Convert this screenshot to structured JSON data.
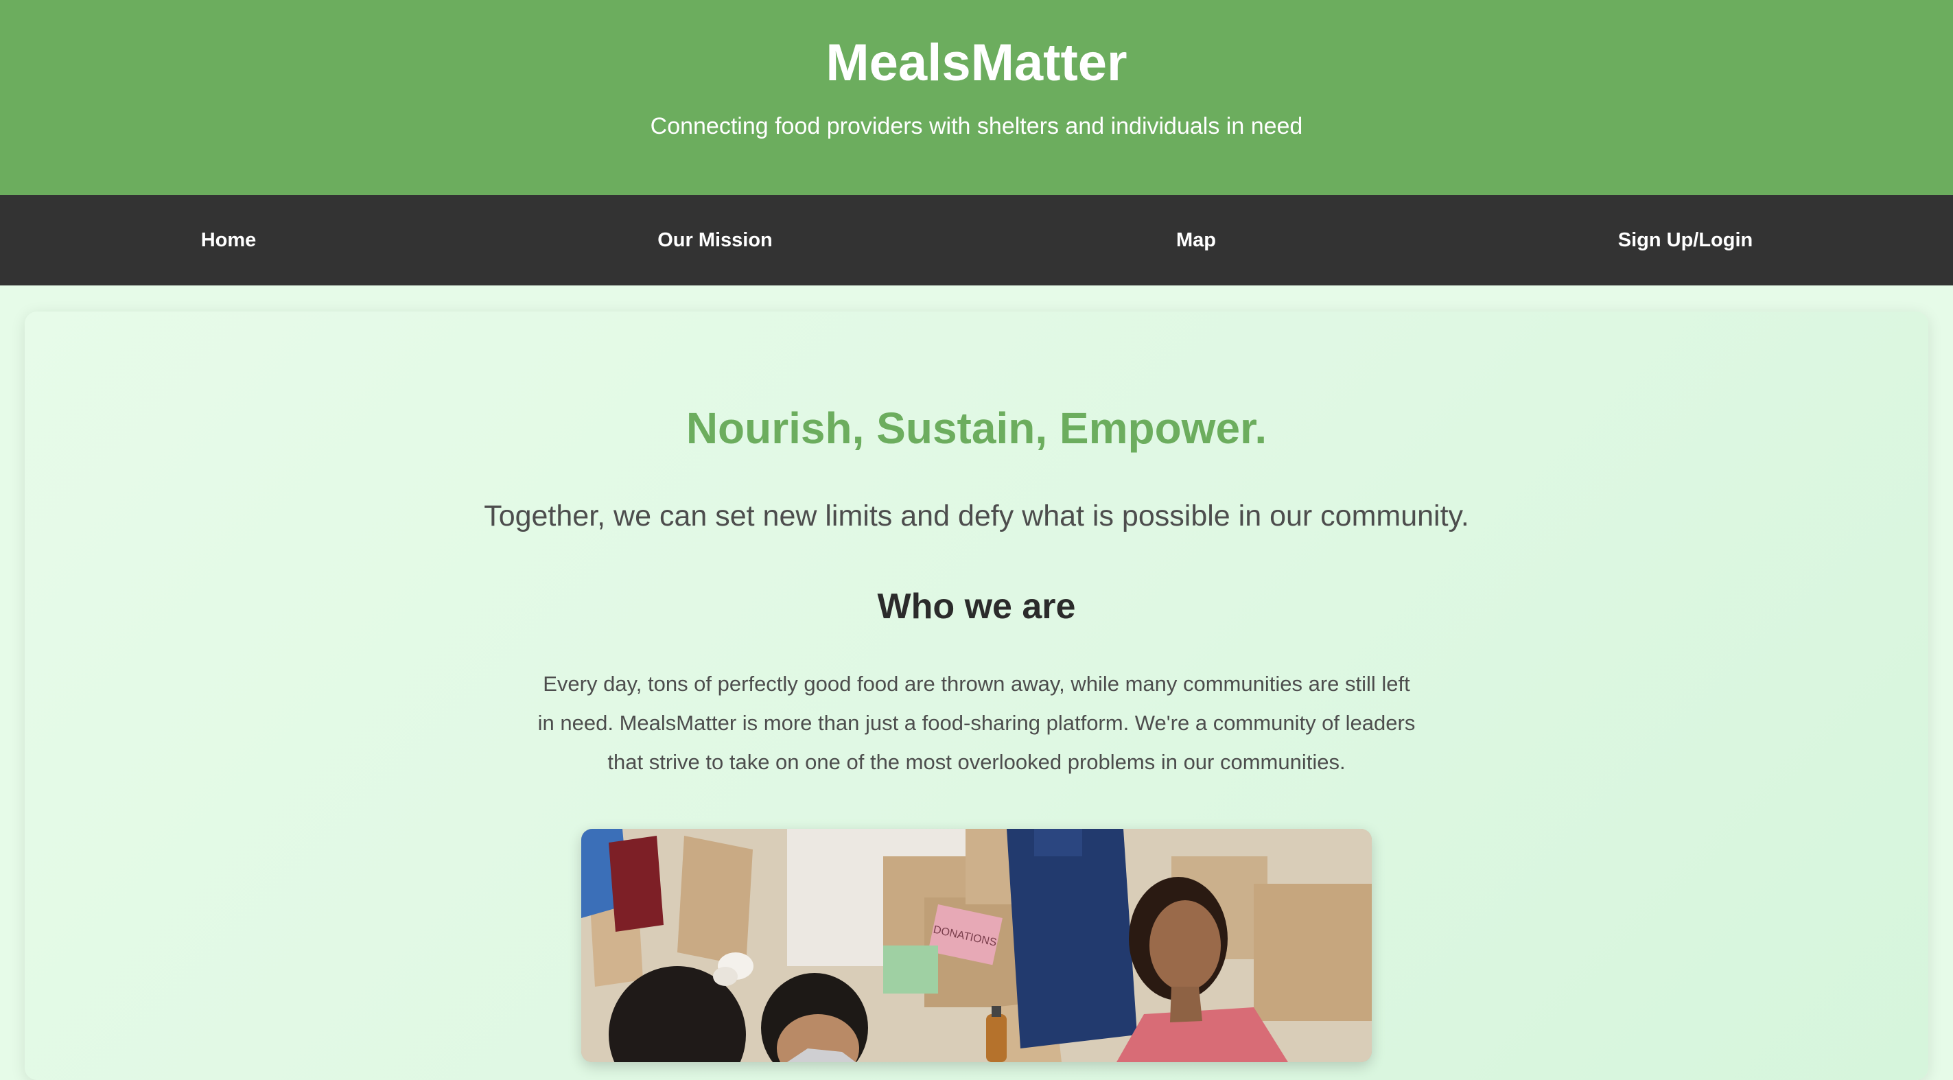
{
  "header": {
    "title": "MealsMatter",
    "tagline": "Connecting food providers with shelters and individuals in need"
  },
  "nav": {
    "items": [
      {
        "label": "Home"
      },
      {
        "label": "Our Mission"
      },
      {
        "label": "Map"
      },
      {
        "label": "Sign Up/Login"
      }
    ]
  },
  "main": {
    "hero_heading": "Nourish, Sustain, Empower.",
    "hero_subheading": "Together, we can set new limits and defy what is possible in our community.",
    "section_heading": "Who we are",
    "section_body": "Every day, tons of perfectly good food are thrown away, while many communities are still left in need. MealsMatter is more than just a food-sharing platform. We're a community of leaders that strive to take on one of the most overlooked problems in our communities.",
    "photo_label": "DONATIONS"
  },
  "colors": {
    "brand_green": "#6cad5e",
    "nav_dark": "#333333",
    "page_background": "#e6fbe8"
  }
}
